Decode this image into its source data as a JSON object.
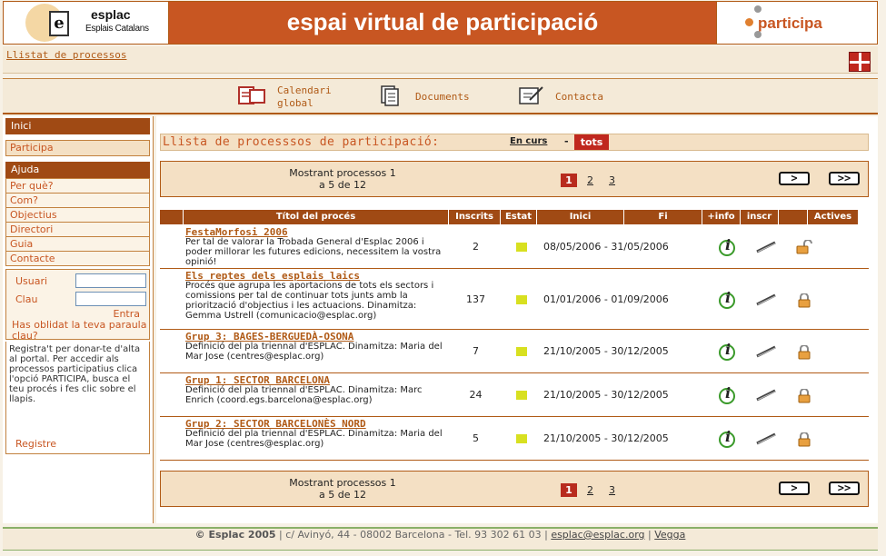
{
  "header": {
    "logo_name": "esplac",
    "logo_sub": "Esplais Catalans",
    "logo_letter": "e",
    "title": "espai virtual de participació",
    "participa": "participa"
  },
  "subbar": {
    "link": "Llistat de processos"
  },
  "nav": {
    "calendar_line1": "Calendari",
    "calendar_line2": "global",
    "documents": "Documents",
    "contact": "Contacta"
  },
  "sidebar": {
    "inici": "Inici",
    "participa": "Participa",
    "ajuda": "Ajuda",
    "items": [
      "Per què?",
      "Com?",
      "Objectius",
      "Directori",
      "Guia",
      "Contacte"
    ],
    "user_label": "Usuari",
    "pass_label": "Clau",
    "enter": "Entra",
    "forgot": "Has oblidat la teva paraula clau?",
    "register_text": "Registra't per donar-te d'alta al portal. Per accedir als processos participatius clica l'opció PARTICIPA, busca el teu procés i fes clic sobre el llapis.",
    "register_link": "Registre"
  },
  "main": {
    "list_title": "Llista de processsos de participació:",
    "filter_active": "En curs",
    "filter_sep": "-",
    "filter_all": "tots",
    "pager_line1": "Mostrant processos 1",
    "pager_line2": "a 5 de 12",
    "pages": [
      "1",
      "2",
      "3"
    ],
    "next": ">",
    "last": ">>",
    "columns": [
      "Títol del procés",
      "Inscrits",
      "Estat",
      "Inici",
      "Fi",
      "+info",
      "inscr",
      "",
      "Actives"
    ],
    "rows": [
      {
        "title": "FestaMorfosi 2006",
        "desc": "Per tal de valorar la Trobada General d'Esplac 2006 i poder millorar les futures edicions, necessitem la vostra opinió!",
        "inscrits": "2",
        "dates": "08/05/2006 - 31/05/2006"
      },
      {
        "title": "Els reptes dels esplais laics",
        "desc": "Procés que agrupa les aportacions de tots els sectors i comissions per tal de continuar tots junts amb la priorització d'objectius i les actuacions. Dinamitza: Gemma Ustrell (comunicacio@esplac.org)",
        "inscrits": "137",
        "dates": "01/01/2006 - 01/09/2006"
      },
      {
        "title": "Grup 3: BAGES-BERGUEDÀ-OSONA",
        "desc": "Definició del pla triennal d'ESPLAC. Dinamitza: Maria del Mar Jose (centres@esplac.org)",
        "inscrits": "7",
        "dates": "21/10/2005 - 30/12/2005"
      },
      {
        "title": "Grup 1: SECTOR BARCELONA",
        "desc": "Definició del pla triennal d'ESPLAC. Dinamitza: Marc Enrich (coord.egs.barcelona@esplac.org)",
        "inscrits": "24",
        "dates": "21/10/2005 - 30/12/2005"
      },
      {
        "title": "Grup 2: SECTOR BARCELONÈS NORD",
        "desc": "Definició del pla triennal d'ESPLAC. Dinamitza: Maria del Mar Jose (centres@esplac.org)",
        "inscrits": "5",
        "dates": "21/10/2005 - 30/12/2005"
      }
    ]
  },
  "footer": {
    "copyright": "© Esplac 2005",
    "address": " | c/ Avinyó, 44 - 08002 Barcelona - Tel. 93 302 61 03 | ",
    "email": "esplac@esplac.org",
    "sep": " | ",
    "credit": "Vegga"
  },
  "colors": {
    "accent": "#c85622",
    "dark_accent": "#a04a14",
    "bg": "#f7f1e6",
    "state_open": "#d8e020"
  }
}
